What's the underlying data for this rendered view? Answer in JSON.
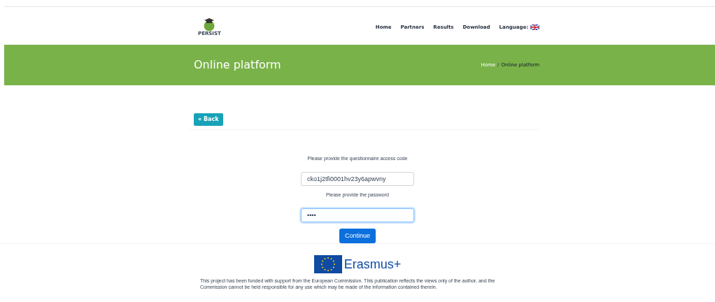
{
  "header": {
    "logo_text": "PERSIST",
    "nav": [
      {
        "label": "Home"
      },
      {
        "label": "Partners"
      },
      {
        "label": "Results"
      },
      {
        "label": "Download"
      },
      {
        "label": "Language:"
      }
    ]
  },
  "banner": {
    "title": "Online platform",
    "breadcrumb_separator": "/",
    "breadcrumb": [
      {
        "label": "Home",
        "current": false
      },
      {
        "label": "Online platform",
        "current": true
      }
    ]
  },
  "back_button": "« Back",
  "form": {
    "fields": [
      {
        "label": "Please provide the questionnaire access code",
        "value": "cko1j2tfi0001hv23y6apwvny",
        "focused": false
      },
      {
        "label": "Please provide the password",
        "value": "••••",
        "focused": true
      }
    ],
    "submit": "Continue"
  },
  "footer": {
    "logo_text": "Erasmus+",
    "disclaimer": "This project has been funded with support from the European Commission. This publication reflects the views only of the author, and the Commission cannot be held responsible for any use which may be made of the information contained therein."
  }
}
